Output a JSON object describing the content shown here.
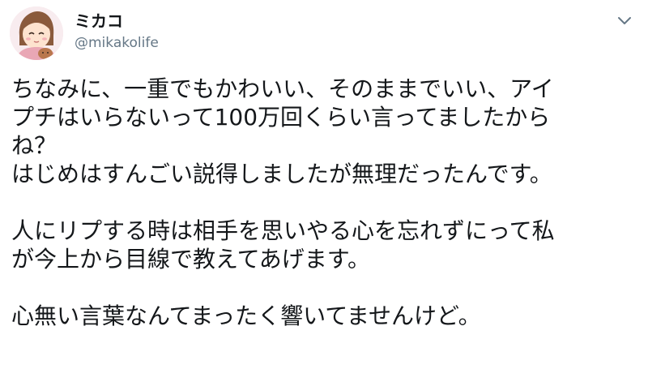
{
  "user": {
    "display_name": "ミカコ",
    "handle": "@mikakolife",
    "avatar_icon": "user-avatar-illustration"
  },
  "menu": {
    "caret_icon": "chevron-down-icon"
  },
  "tweet": {
    "paragraphs": [
      [
        "ちなみに、一重でもかわいい、そのままでいい、アイ",
        "プチはいらないって100万回くらい言ってましたから",
        "ね？",
        "はじめはすんごい説得しましたが無理だったんです。"
      ],
      [
        "人にリプする時は相手を思いやる心を忘れずにって私",
        "が今上から目線で教えてあげます。"
      ],
      [
        "心無い言葉なんてまったく響いてませんけど。"
      ]
    ]
  },
  "colors": {
    "text": "#14171a",
    "secondary": "#657786",
    "background": "#ffffff"
  }
}
